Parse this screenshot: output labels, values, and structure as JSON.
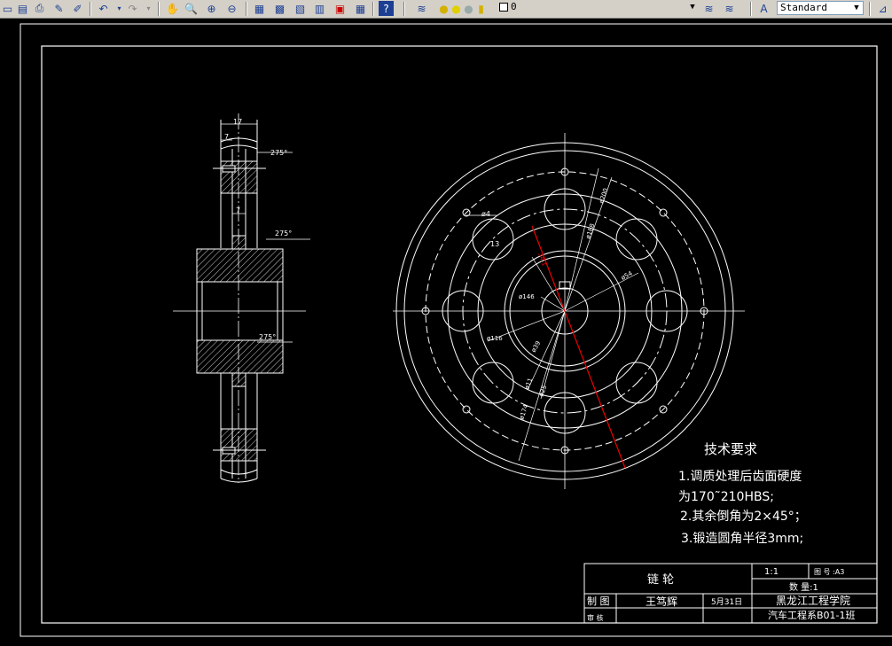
{
  "toolbar": {
    "icons": [
      "open-icon",
      "save-icon",
      "print-icon",
      "cut-icon",
      "match-properties-icon",
      "undo-icon",
      "redo-icon",
      "pan-icon",
      "zoom-realtime-icon",
      "zoom-window-icon",
      "zoom-previous-icon",
      "properties-icon",
      "design-center-icon",
      "tool-palettes-icon",
      "sheet-set-icon",
      "markup-icon",
      "calculator-icon",
      "help-icon",
      "layer-manager-icon",
      "layer-state-icon",
      "layer-previous-icon",
      "text-style-icon"
    ],
    "layer_value": "0",
    "text_style_value": "Standard"
  },
  "drawing": {
    "side_view": {
      "dim_width": "17",
      "dim_7_top": "7",
      "dim_7_mid": "7",
      "rough_1": "2.75 ∀",
      "rough_2": "2.75 ∀",
      "rough_3": "2.75 ∀",
      "rough_1_label": "275°",
      "rough_2_label": "275°",
      "rough_3_label": "275°"
    },
    "front_view": {
      "dim_phi4": "ø4",
      "dim_13": "13",
      "dim_phi146": "ø146",
      "dim_phi116": "ø116",
      "dim_phi39": "ø39",
      "dim_phi11": "ø11",
      "dim_phi25": "ø25",
      "dim_phi174": "ø174",
      "dim_phi200": "ø200",
      "dim_phi188": "ø188",
      "dim_phi54": "ø54",
      "dim_key": "34.1"
    },
    "tech_requirements": {
      "title": "技术要求",
      "line1": "1.调质处理后齿面硬度",
      "line2": "为170˜210HBS;",
      "line3": "2.其余倒角为2×45°；",
      "line4": "3.锻造圆角半径3mm;"
    },
    "title_block": {
      "part_name": "链    轮",
      "scale": "1:1",
      "drawing_no_label": "图 号 :A3",
      "quantity": "数    量:1",
      "drawn_label": "制  图",
      "reviewer_label": "审  核",
      "drawer_name": "王笃辉",
      "date": "5月31日",
      "school": "黑龙江工程学院",
      "class": "汽车工程系B01-1班"
    }
  }
}
